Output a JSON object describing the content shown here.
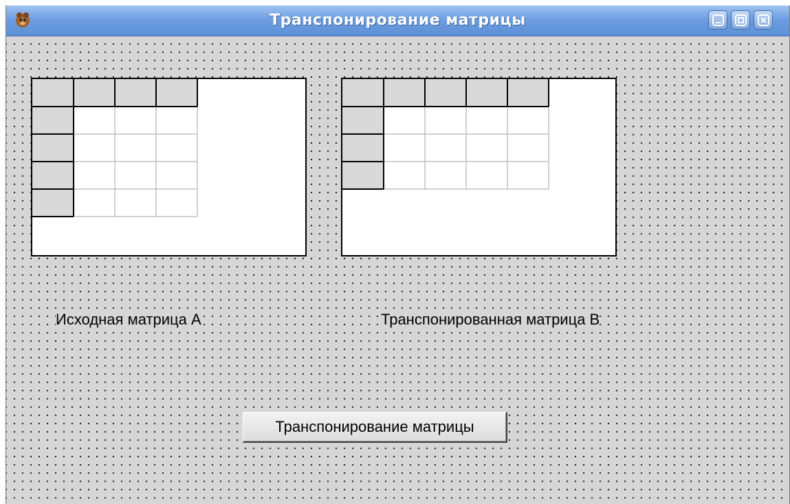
{
  "window": {
    "title": "Транспонирование матрицы",
    "controls": [
      "minimize-icon",
      "maximize-icon",
      "close-icon"
    ]
  },
  "form": {
    "label_a": "Исходная матрица А",
    "label_b": "Транспонированная матрица В",
    "transpose_button_label": "Транспонирование матрицы"
  },
  "grids": {
    "matrix_a": {
      "columns": 4,
      "rows": 5,
      "fixed_rows": 1,
      "fixed_columns": 1
    },
    "matrix_b": {
      "columns": 5,
      "rows": 4,
      "fixed_rows": 1,
      "fixed_columns": 1
    }
  },
  "colors": {
    "title_bar": "#6f9ee0",
    "form_background": "#d6d6d6",
    "fixed_cell": "#d9d9d9",
    "grid_line": "#c0c0c0"
  }
}
